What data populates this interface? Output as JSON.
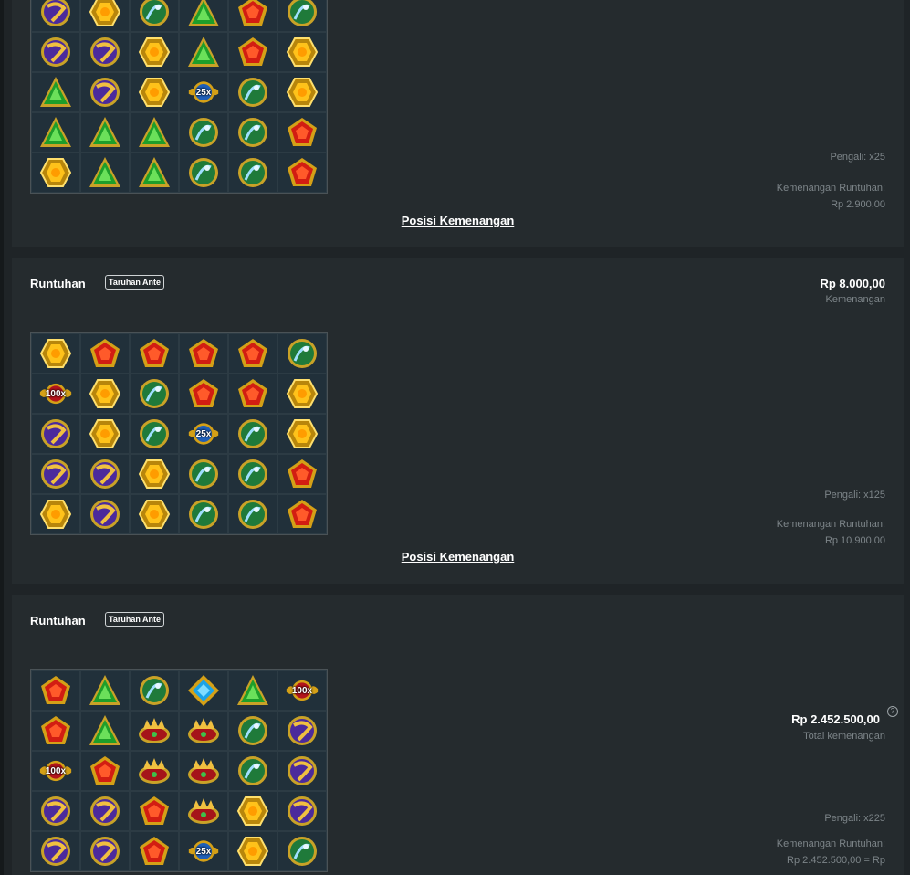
{
  "colors": {
    "background": "#1f2427",
    "card": "#252b2e",
    "muted_text": "#7d8589"
  },
  "cards": [
    {
      "multiplier_text": "Pengali: x25",
      "cascade_label": "Kemenangan Runtuhan:",
      "cascade_value": "Rp 2.900,00",
      "link_label": "Posisi Kemenangan",
      "grid": [
        [
          "purple-horn",
          "yellow-hex",
          "green-orb",
          "green-triangle",
          "red-pentagon",
          "green-orb"
        ],
        [
          "purple-horn",
          "purple-horn",
          "yellow-hex",
          "green-triangle",
          "red-pentagon",
          "yellow-hex"
        ],
        [
          "green-triangle",
          "purple-horn",
          "yellow-hex",
          "blue-25x",
          "green-orb",
          "yellow-hex"
        ],
        [
          "green-triangle",
          "green-triangle",
          "green-triangle",
          "green-orb",
          "green-orb",
          "red-pentagon"
        ],
        [
          "yellow-hex",
          "green-triangle",
          "green-triangle",
          "green-orb",
          "green-orb",
          "red-pentagon"
        ]
      ]
    },
    {
      "title": "Runtuhan",
      "badge": "Taruhan Ante",
      "win_amount": "Rp 8.000,00",
      "win_caption": "Kemenangan",
      "multiplier_text": "Pengali: x125",
      "cascade_label": "Kemenangan Runtuhan:",
      "cascade_value": "Rp 10.900,00",
      "link_label": "Posisi Kemenangan",
      "grid": [
        [
          "yellow-hex",
          "red-pentagon",
          "red-pentagon",
          "red-pentagon",
          "red-pentagon",
          "green-orb"
        ],
        [
          "red-100x",
          "yellow-hex",
          "green-orb",
          "red-pentagon",
          "red-pentagon",
          "yellow-hex"
        ],
        [
          "purple-horn",
          "yellow-hex",
          "green-orb",
          "blue-25x",
          "green-orb",
          "yellow-hex"
        ],
        [
          "purple-horn",
          "purple-horn",
          "yellow-hex",
          "green-orb",
          "green-orb",
          "red-pentagon"
        ],
        [
          "yellow-hex",
          "purple-horn",
          "yellow-hex",
          "green-orb",
          "green-orb",
          "red-pentagon"
        ]
      ]
    },
    {
      "title": "Runtuhan",
      "badge": "Taruhan Ante",
      "win_amount": "Rp 2.452.500,00",
      "win_caption": "Total kemenangan",
      "help_icon": "?",
      "multiplier_text": "Pengali: x225",
      "cascade_label": "Kemenangan Runtuhan:",
      "cascade_value": "Rp 2.452.500,00 = Rp",
      "grid": [
        [
          "red-pentagon",
          "green-triangle",
          "green-orb",
          "blue-diamond",
          "green-triangle",
          "red-100x"
        ],
        [
          "red-pentagon",
          "green-triangle",
          "red-crown",
          "red-crown",
          "green-orb",
          "purple-horn"
        ],
        [
          "red-100x",
          "red-pentagon",
          "red-crown",
          "red-crown",
          "green-orb",
          "purple-horn"
        ],
        [
          "purple-horn",
          "purple-horn",
          "red-pentagon",
          "red-crown",
          "yellow-hex",
          "purple-horn"
        ],
        [
          "purple-horn",
          "purple-horn",
          "red-pentagon",
          "blue-25x",
          "yellow-hex",
          "green-orb"
        ]
      ]
    }
  ],
  "multiplier_labels": {
    "blue-25x": "25x",
    "red-100x": "100x"
  }
}
